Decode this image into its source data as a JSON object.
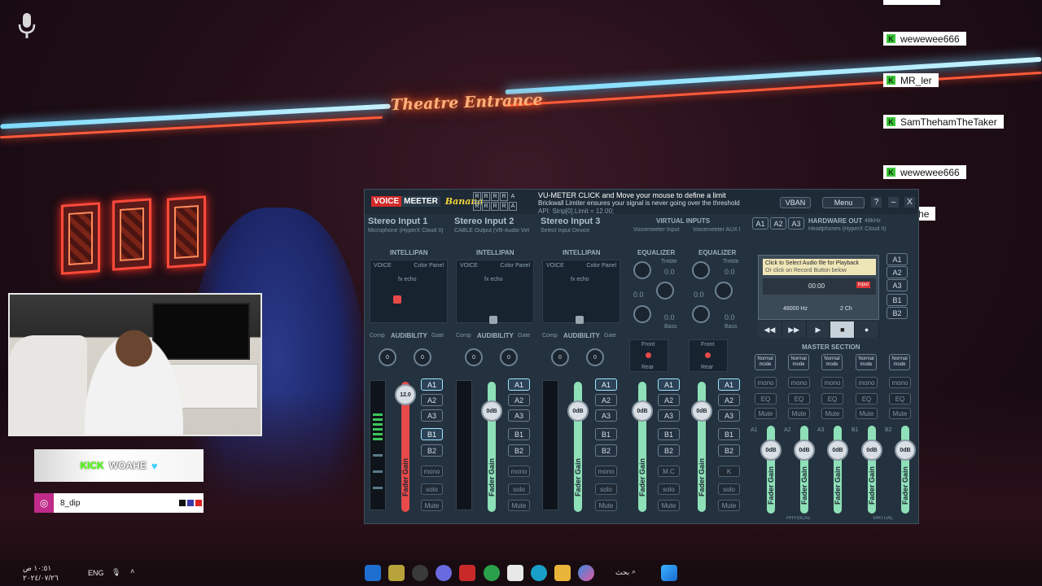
{
  "stream": {
    "banner_kick": "KICK",
    "banner_name": "WOAHE",
    "banner_heart": "♥",
    "instagram_handle": "8_dip",
    "sign_text": "Theatre Entrance"
  },
  "chat": {
    "messages": [
      {
        "user": "wewewee666"
      },
      {
        "user": "MR_ler"
      },
      {
        "user": "SamThehamTheTaker"
      },
      {
        "user": "wewewee666"
      },
      {
        "user": "woahe"
      }
    ]
  },
  "voicemeeter": {
    "logo_voice": "VOICE",
    "logo_meeter": "MEETER",
    "logo_edition": "Banana",
    "r_labels": [
      "R",
      "R",
      "R",
      "R",
      "A",
      "R",
      "R",
      "R",
      "R",
      "A"
    ],
    "vu_line1": "VU-METER  CLICK and Move your mouse to define a limit",
    "vu_line2": "Brickwall Limiter ensures your signal is never going over the threshold",
    "vu_line3": "API: Strip[0].Limit = 12.00;",
    "vban": "VBAN",
    "menu": "Menu",
    "help": "?",
    "close": "X",
    "strips": [
      {
        "title": "Stereo Input 1",
        "device": "Microphone (HyperX Cloud II)",
        "intellipan": "INTELLIPAN",
        "voice": "VOICE",
        "color_panel": "Color Panel",
        "fx": "fx echo",
        "fader": "12.0",
        "fader_label": "Fader Gain"
      },
      {
        "title": "Stereo Input 2",
        "device": "CABLE Output (VB-Audio Virt",
        "intellipan": "INTELLIPAN",
        "voice": "VOICE",
        "color_panel": "Color Panel",
        "fx": "fx echo",
        "fader": "0dB",
        "fader_label": "Fader Gain"
      },
      {
        "title": "Stereo Input 3",
        "device": "Select Input Device",
        "intellipan": "INTELLIPAN",
        "voice": "VOICE",
        "color_panel": "Color Panel",
        "fx": "fx echo",
        "fader": "0dB",
        "fader_label": "Fader Gain"
      }
    ],
    "virtual_inputs": "VIRTUAL INPUTS",
    "virtual": [
      {
        "name": "Voicemeeter Input",
        "eq": "EQUALIZER",
        "fader": "0dB",
        "fader_label": "Fader Gain",
        "mc": "M.C",
        "front": "Front",
        "rear": "Rear"
      },
      {
        "name": "Voicemeeter AUX I",
        "eq": "EQUALIZER",
        "fader": "0dB",
        "fader_label": "Fader Gain",
        "mc": "K",
        "front": "Front",
        "rear": "Rear"
      }
    ],
    "eq_values": [
      "0.0",
      "0.0",
      "0.0"
    ],
    "treble": "Treble",
    "bass": "Bass",
    "comp": "Comp",
    "audibility": "AUDIBILITY",
    "gate": "Gate",
    "bus_a": [
      "A1",
      "A2",
      "A3"
    ],
    "bus_b": [
      "B1",
      "B2"
    ],
    "mono": "mono",
    "solo": "solo",
    "mute": "Mute",
    "hardware_out": "HARDWARE OUT",
    "hardware_out_rate": "48kHz",
    "hardware_device": "Headphones (HyperX Cloud II)",
    "player_msg1": "Click to Select Audio file for Playback",
    "player_msg2": "Or click on Record Button below",
    "player_time": "00:00",
    "player_input": "input",
    "player_rate": "48000 Hz",
    "player_ch": "2 Ch",
    "master_section": "MASTER SECTION",
    "master": [
      {
        "bus": "A1",
        "mode": "Normal mode",
        "fader": "0dB"
      },
      {
        "bus": "A2",
        "mode": "Normal mode",
        "fader": "0dB"
      },
      {
        "bus": "A3",
        "mode": "Normal mode",
        "fader": "0dB"
      },
      {
        "bus": "B1",
        "mode": "Normal mode",
        "fader": "0dB"
      },
      {
        "bus": "B2",
        "mode": "Normal mode",
        "fader": "0dB"
      }
    ],
    "master_eq": "EQ",
    "physical": "PHYSICAL",
    "virtual_label": "VIRTUAL",
    "colors": {
      "input1_fader": "#e84a4a",
      "fader_green": "#8ee0b8",
      "panel": "#24323f"
    }
  },
  "taskbar": {
    "time": "١٠:٥١ ص",
    "date": "٢٠٢٤/٠٧/٢٦",
    "lang": "ENG",
    "search": "بحث"
  }
}
